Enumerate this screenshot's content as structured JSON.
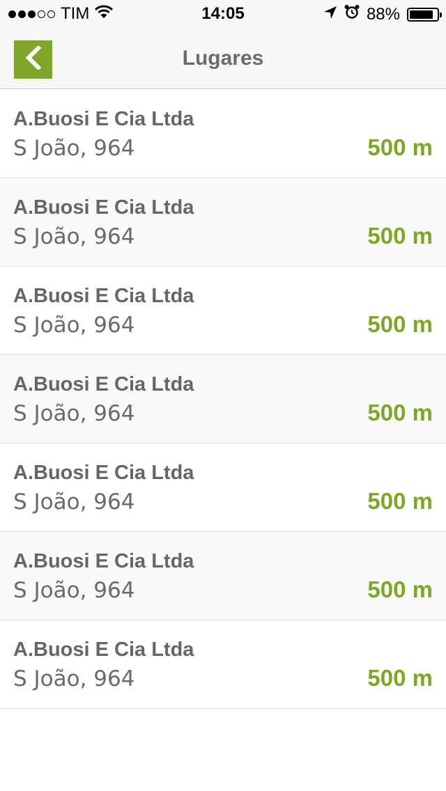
{
  "status_bar": {
    "carrier": "TIM",
    "signal_bars_filled": 3,
    "signal_bars_total": 5,
    "time": "14:05",
    "battery_percent": "88%",
    "battery_level": 0.88,
    "icons": [
      "wifi-icon",
      "location-arrow-icon",
      "alarm-icon",
      "battery-icon"
    ]
  },
  "nav": {
    "title": "Lugares",
    "back_icon": "chevron-left-icon",
    "accent_color": "#7ea628"
  },
  "places": [
    {
      "name": "A.Buosi E Cia Ltda",
      "address": "S João, 964",
      "distance": "500 m"
    },
    {
      "name": "A.Buosi E Cia Ltda",
      "address": "S João, 964",
      "distance": "500 m"
    },
    {
      "name": "A.Buosi E Cia Ltda",
      "address": "S João, 964",
      "distance": "500 m"
    },
    {
      "name": "A.Buosi E Cia Ltda",
      "address": "S João, 964",
      "distance": "500 m"
    },
    {
      "name": "A.Buosi E Cia Ltda",
      "address": "S João, 964",
      "distance": "500 m"
    },
    {
      "name": "A.Buosi E Cia Ltda",
      "address": "S João, 964",
      "distance": "500 m"
    },
    {
      "name": "A.Buosi E Cia Ltda",
      "address": "S João, 964",
      "distance": "500 m"
    }
  ]
}
